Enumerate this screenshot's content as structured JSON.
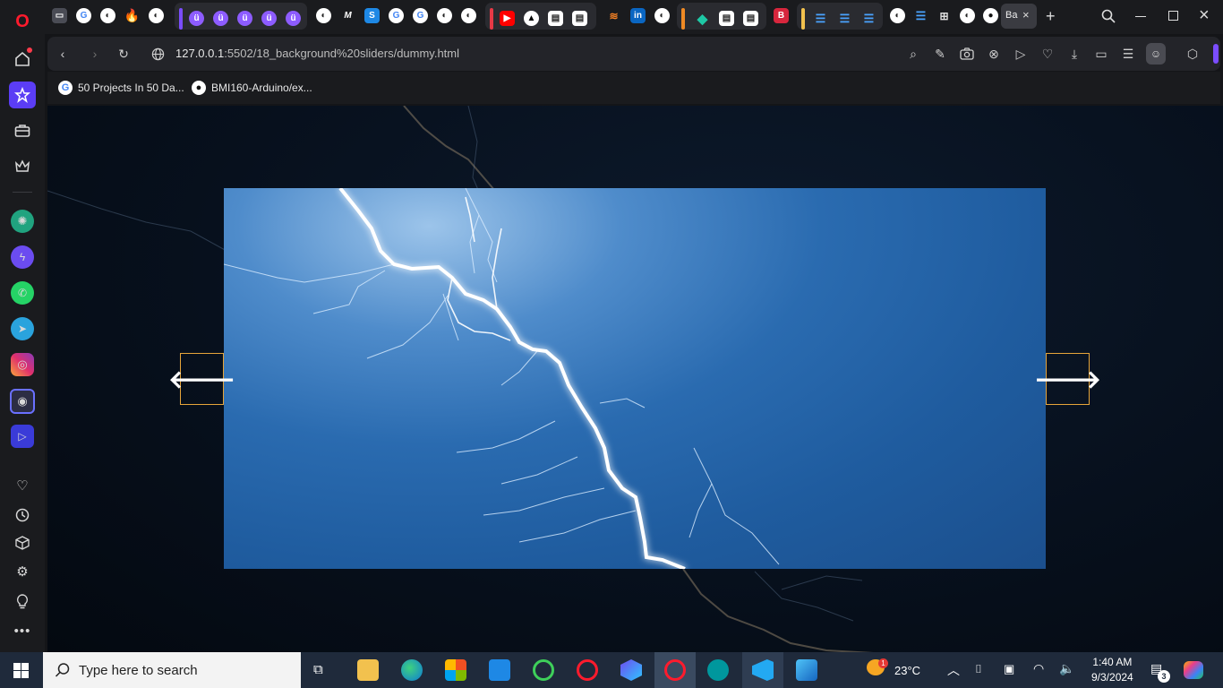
{
  "browser": {
    "url_host": "127.0.0.1",
    "url_rest": ":5502/18_background%20sliders/dummy.html",
    "active_tab_label": "Ba",
    "bookmarks": [
      {
        "label": "50 Projects In 50 Da..."
      },
      {
        "label": "BMI160-Arduino/ex..."
      }
    ]
  },
  "slider": {
    "prev_icon": "arrow-left",
    "next_icon": "arrow-right",
    "accent": "#e7a53a",
    "image": "lightning-storm"
  },
  "taskbar": {
    "search_placeholder": "Type here to search",
    "weather": "23°C",
    "time": "1:40 AM",
    "date": "9/3/2024",
    "weather_badge": "1",
    "notification_count": "3"
  }
}
